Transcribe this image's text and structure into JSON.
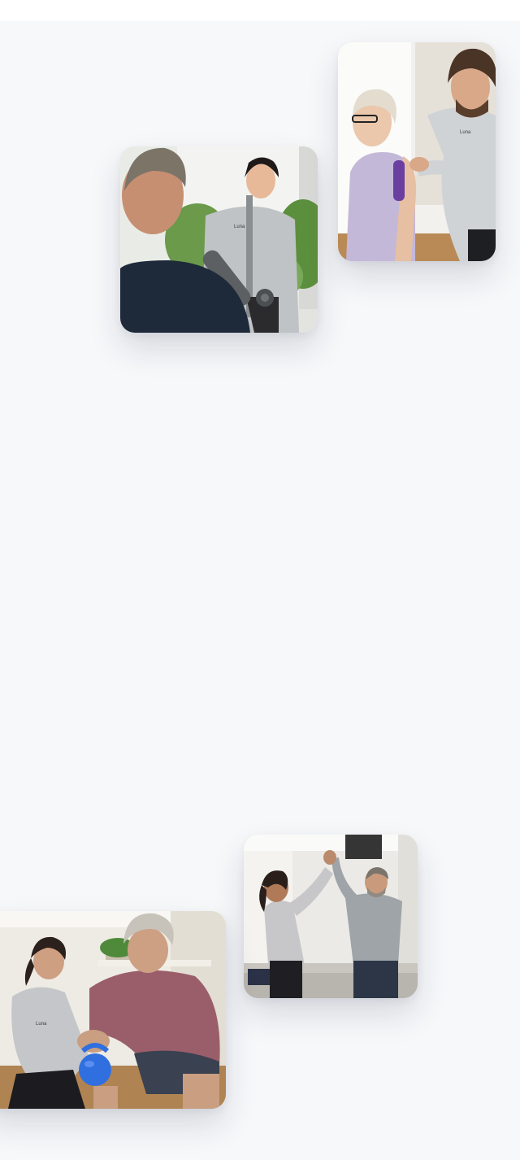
{
  "photos": [
    {
      "id": "doorway",
      "scene": "therapist-greeting-patient-at-door",
      "logo_text": "Luna"
    },
    {
      "id": "taping",
      "scene": "therapist-applying-kinesiology-tape",
      "logo_text": "Luna"
    },
    {
      "id": "highfive",
      "scene": "therapist-high-five-patient",
      "logo_text": ""
    },
    {
      "id": "kettle",
      "scene": "therapist-coaching-kettlebell-squat",
      "logo_text": "Luna"
    }
  ],
  "colors": {
    "page_background": "#f7f8fa",
    "luna_accent": "#5b4fc9",
    "kinesiology_tape": "#6b3fa0",
    "kettlebell": "#2f6fe0"
  }
}
